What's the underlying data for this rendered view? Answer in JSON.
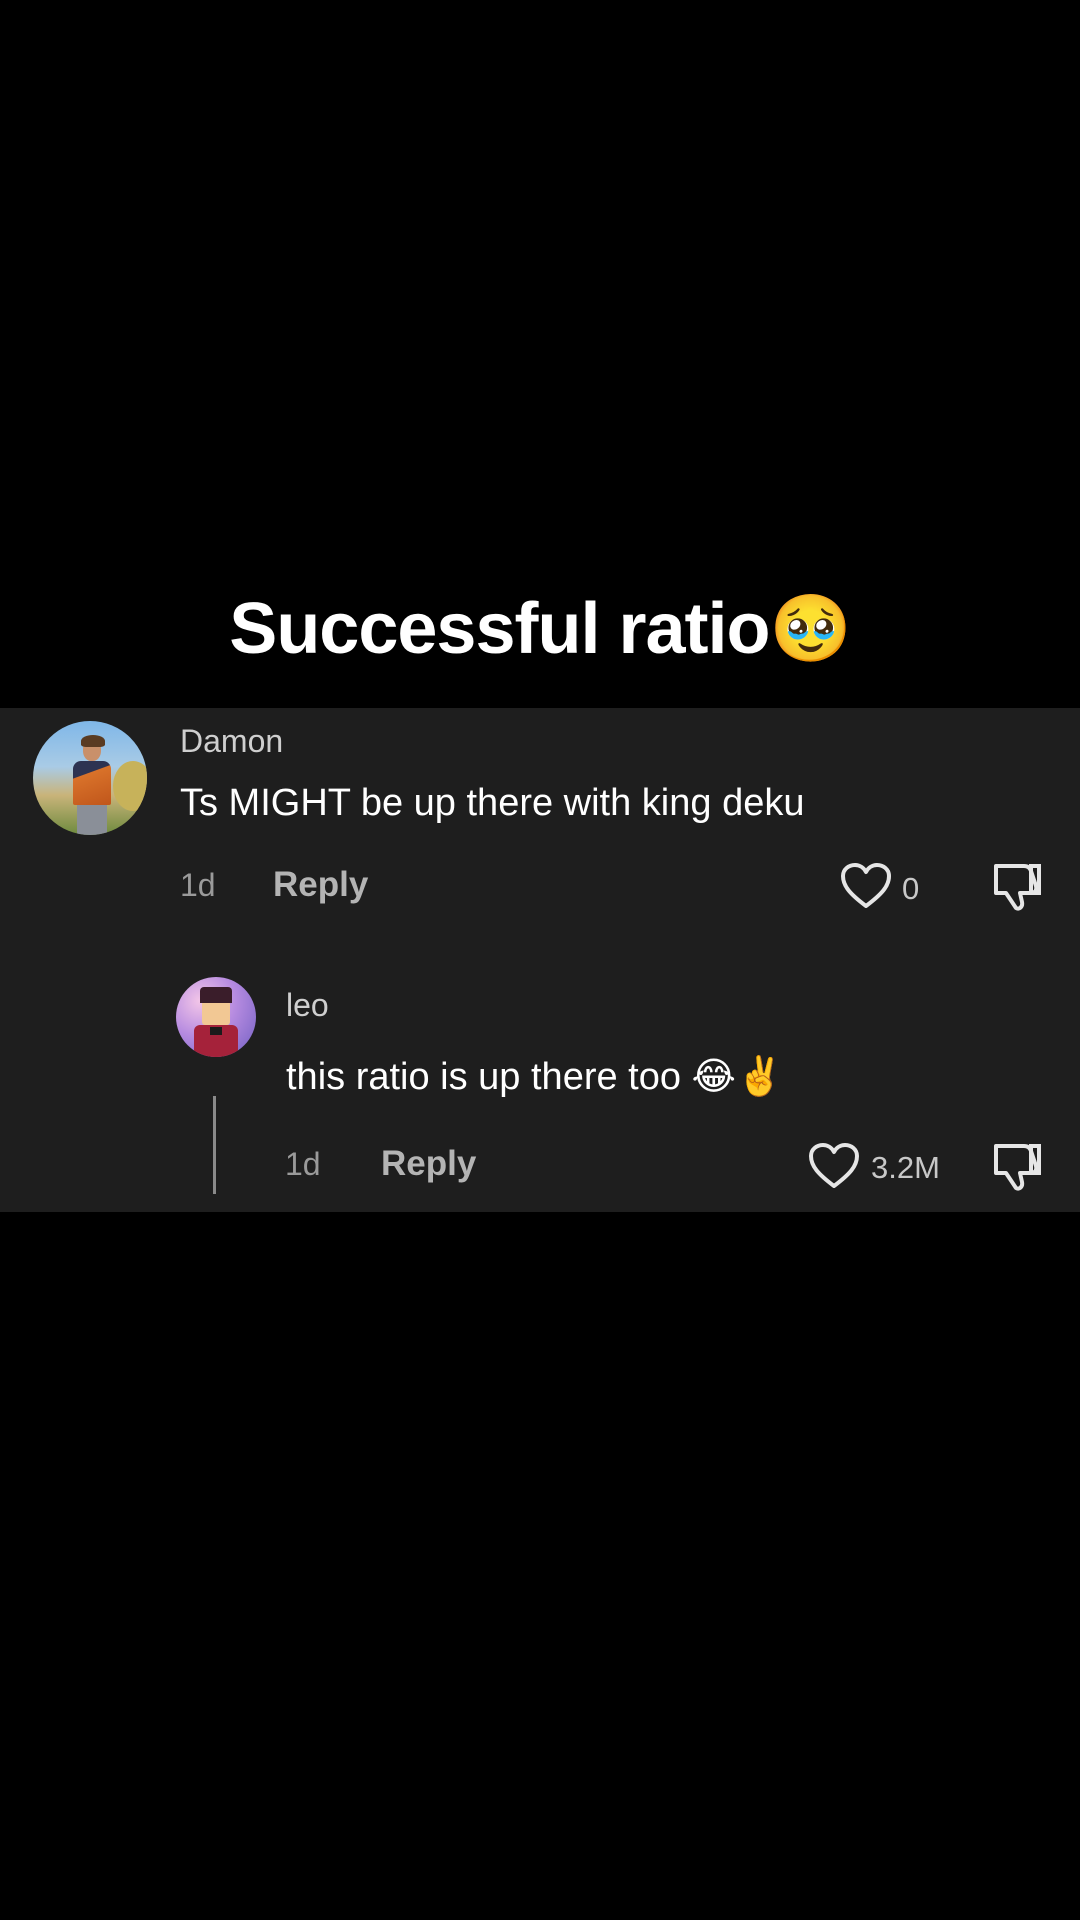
{
  "caption": {
    "text": "Successful ratio",
    "emoji": "🥹"
  },
  "comments": [
    {
      "username": "Damon",
      "text": "Ts MIGHT be up there with king deku",
      "time": "1d",
      "reply_label": "Reply",
      "likes": "0",
      "icons": [
        "heart-icon",
        "thumbs-down-icon"
      ]
    },
    {
      "username": "leo",
      "text": "this ratio is up there too 😂✌️",
      "time": "1d",
      "reply_label": "Reply",
      "likes": "3.2M",
      "icons": [
        "heart-icon",
        "thumbs-down-icon"
      ]
    }
  ],
  "colors": {
    "background": "#000000",
    "panel": "#1e1e1e",
    "text_primary": "#ffffff",
    "text_secondary": "#9a9a9a"
  }
}
